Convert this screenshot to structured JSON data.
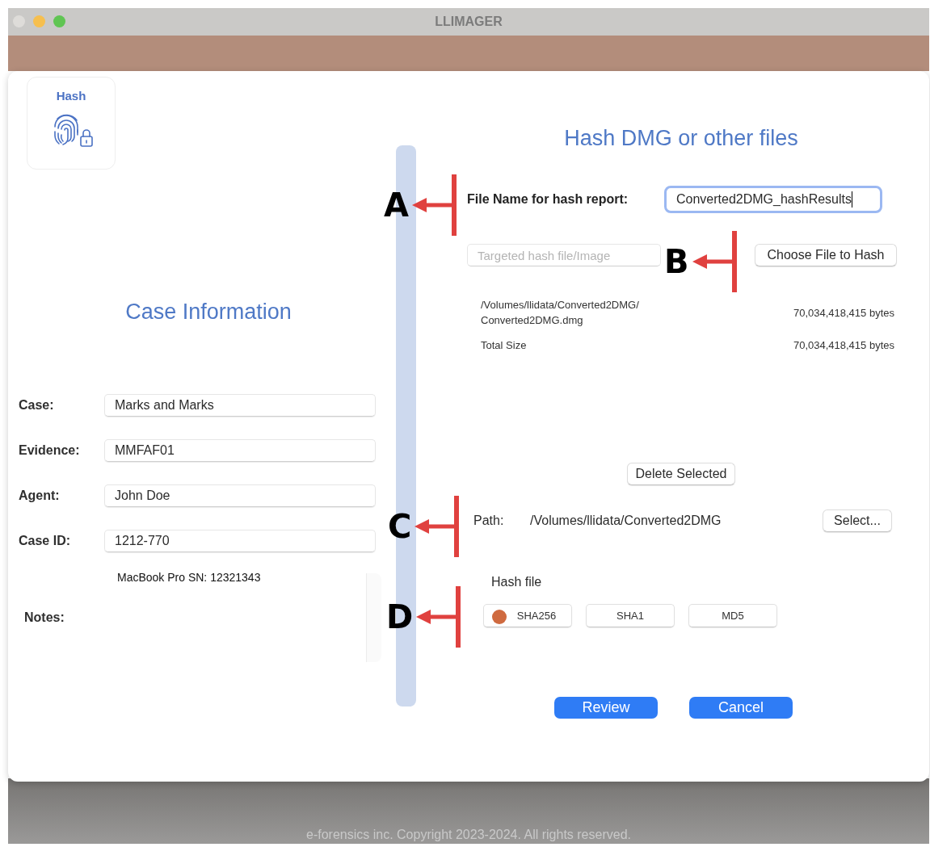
{
  "window": {
    "title": "LLIMAGER"
  },
  "tool_tile": {
    "label": "Hash"
  },
  "case_panel": {
    "title": "Case Information",
    "fields": [
      {
        "label": "Case:",
        "value": "Marks and Marks"
      },
      {
        "label": "Evidence:",
        "value": "MMFAF01"
      },
      {
        "label": "Agent:",
        "value": "John Doe"
      },
      {
        "label": "Case ID:",
        "value": "1212-770"
      }
    ],
    "notes": {
      "label": "Notes:",
      "value": "MacBook Pro SN: 12321343"
    }
  },
  "hash_panel": {
    "title": "Hash DMG or other files",
    "report_name": {
      "label": "File Name for hash report:",
      "value": "Converted2DMG_hashResults"
    },
    "target": {
      "placeholder": "Targeted hash file/Image",
      "button": "Choose File to Hash"
    },
    "files": [
      {
        "name": "/Volumes/llidata/Converted2DMG/\nConverted2DMG.dmg",
        "size": "70,034,418,415 bytes"
      },
      {
        "name": "Total Size",
        "size": "70,034,418,415 bytes"
      }
    ],
    "delete_button": "Delete Selected",
    "path": {
      "label": "Path:",
      "value": "/Volumes/llidata/Converted2DMG",
      "button": "Select..."
    },
    "hash_label": "Hash file",
    "algorithms": [
      {
        "label": "SHA256",
        "selected": true
      },
      {
        "label": "SHA1",
        "selected": false
      },
      {
        "label": "MD5",
        "selected": false
      }
    ],
    "buttons": [
      "Review",
      "Cancel"
    ]
  },
  "annotations": [
    {
      "label": "A"
    },
    {
      "label": "B"
    },
    {
      "label": "C"
    },
    {
      "label": "D"
    }
  ],
  "footer": "e-forensics inc. Copyright 2023-2024. All rights reserved."
}
